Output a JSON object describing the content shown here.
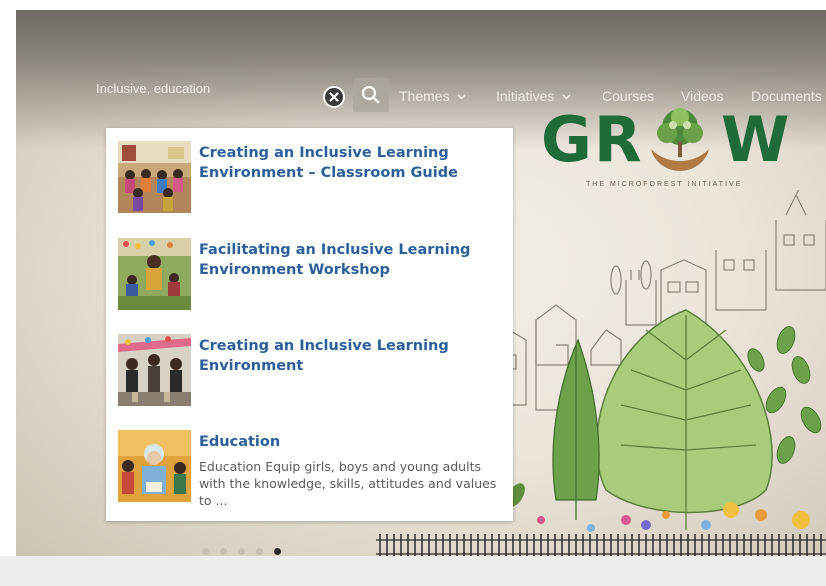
{
  "search": {
    "value": "Inclusive, education",
    "clear_icon": "close-icon",
    "search_icon": "search-icon"
  },
  "nav": {
    "items": [
      {
        "label": "Themes",
        "has_dropdown": true
      },
      {
        "label": "Initiatives",
        "has_dropdown": true
      },
      {
        "label": "Courses",
        "has_dropdown": false
      },
      {
        "label": "Videos",
        "has_dropdown": false
      },
      {
        "label": "Documents",
        "has_dropdown": false
      }
    ]
  },
  "logo": {
    "text_left": "GR",
    "text_right": "W",
    "tagline": "THE MICROFOREST INITIATIVE",
    "color": "#1f6b39"
  },
  "results": [
    {
      "title": "Creating an Inclusive Learning Environment – Classroom Guide",
      "description": ""
    },
    {
      "title": "Facilitating an Inclusive Learning Environment Workshop",
      "description": ""
    },
    {
      "title": "Creating an Inclusive Learning Environment",
      "description": ""
    },
    {
      "title": "Education",
      "description": "Education Equip girls, boys and young adults with the knowledge, skills, attitudes and values to ..."
    }
  ],
  "carousel": {
    "dot_count": 5,
    "active_dot": 5
  },
  "colors": {
    "result_title": "#2b5f9a",
    "nav_text": "#efece6"
  }
}
